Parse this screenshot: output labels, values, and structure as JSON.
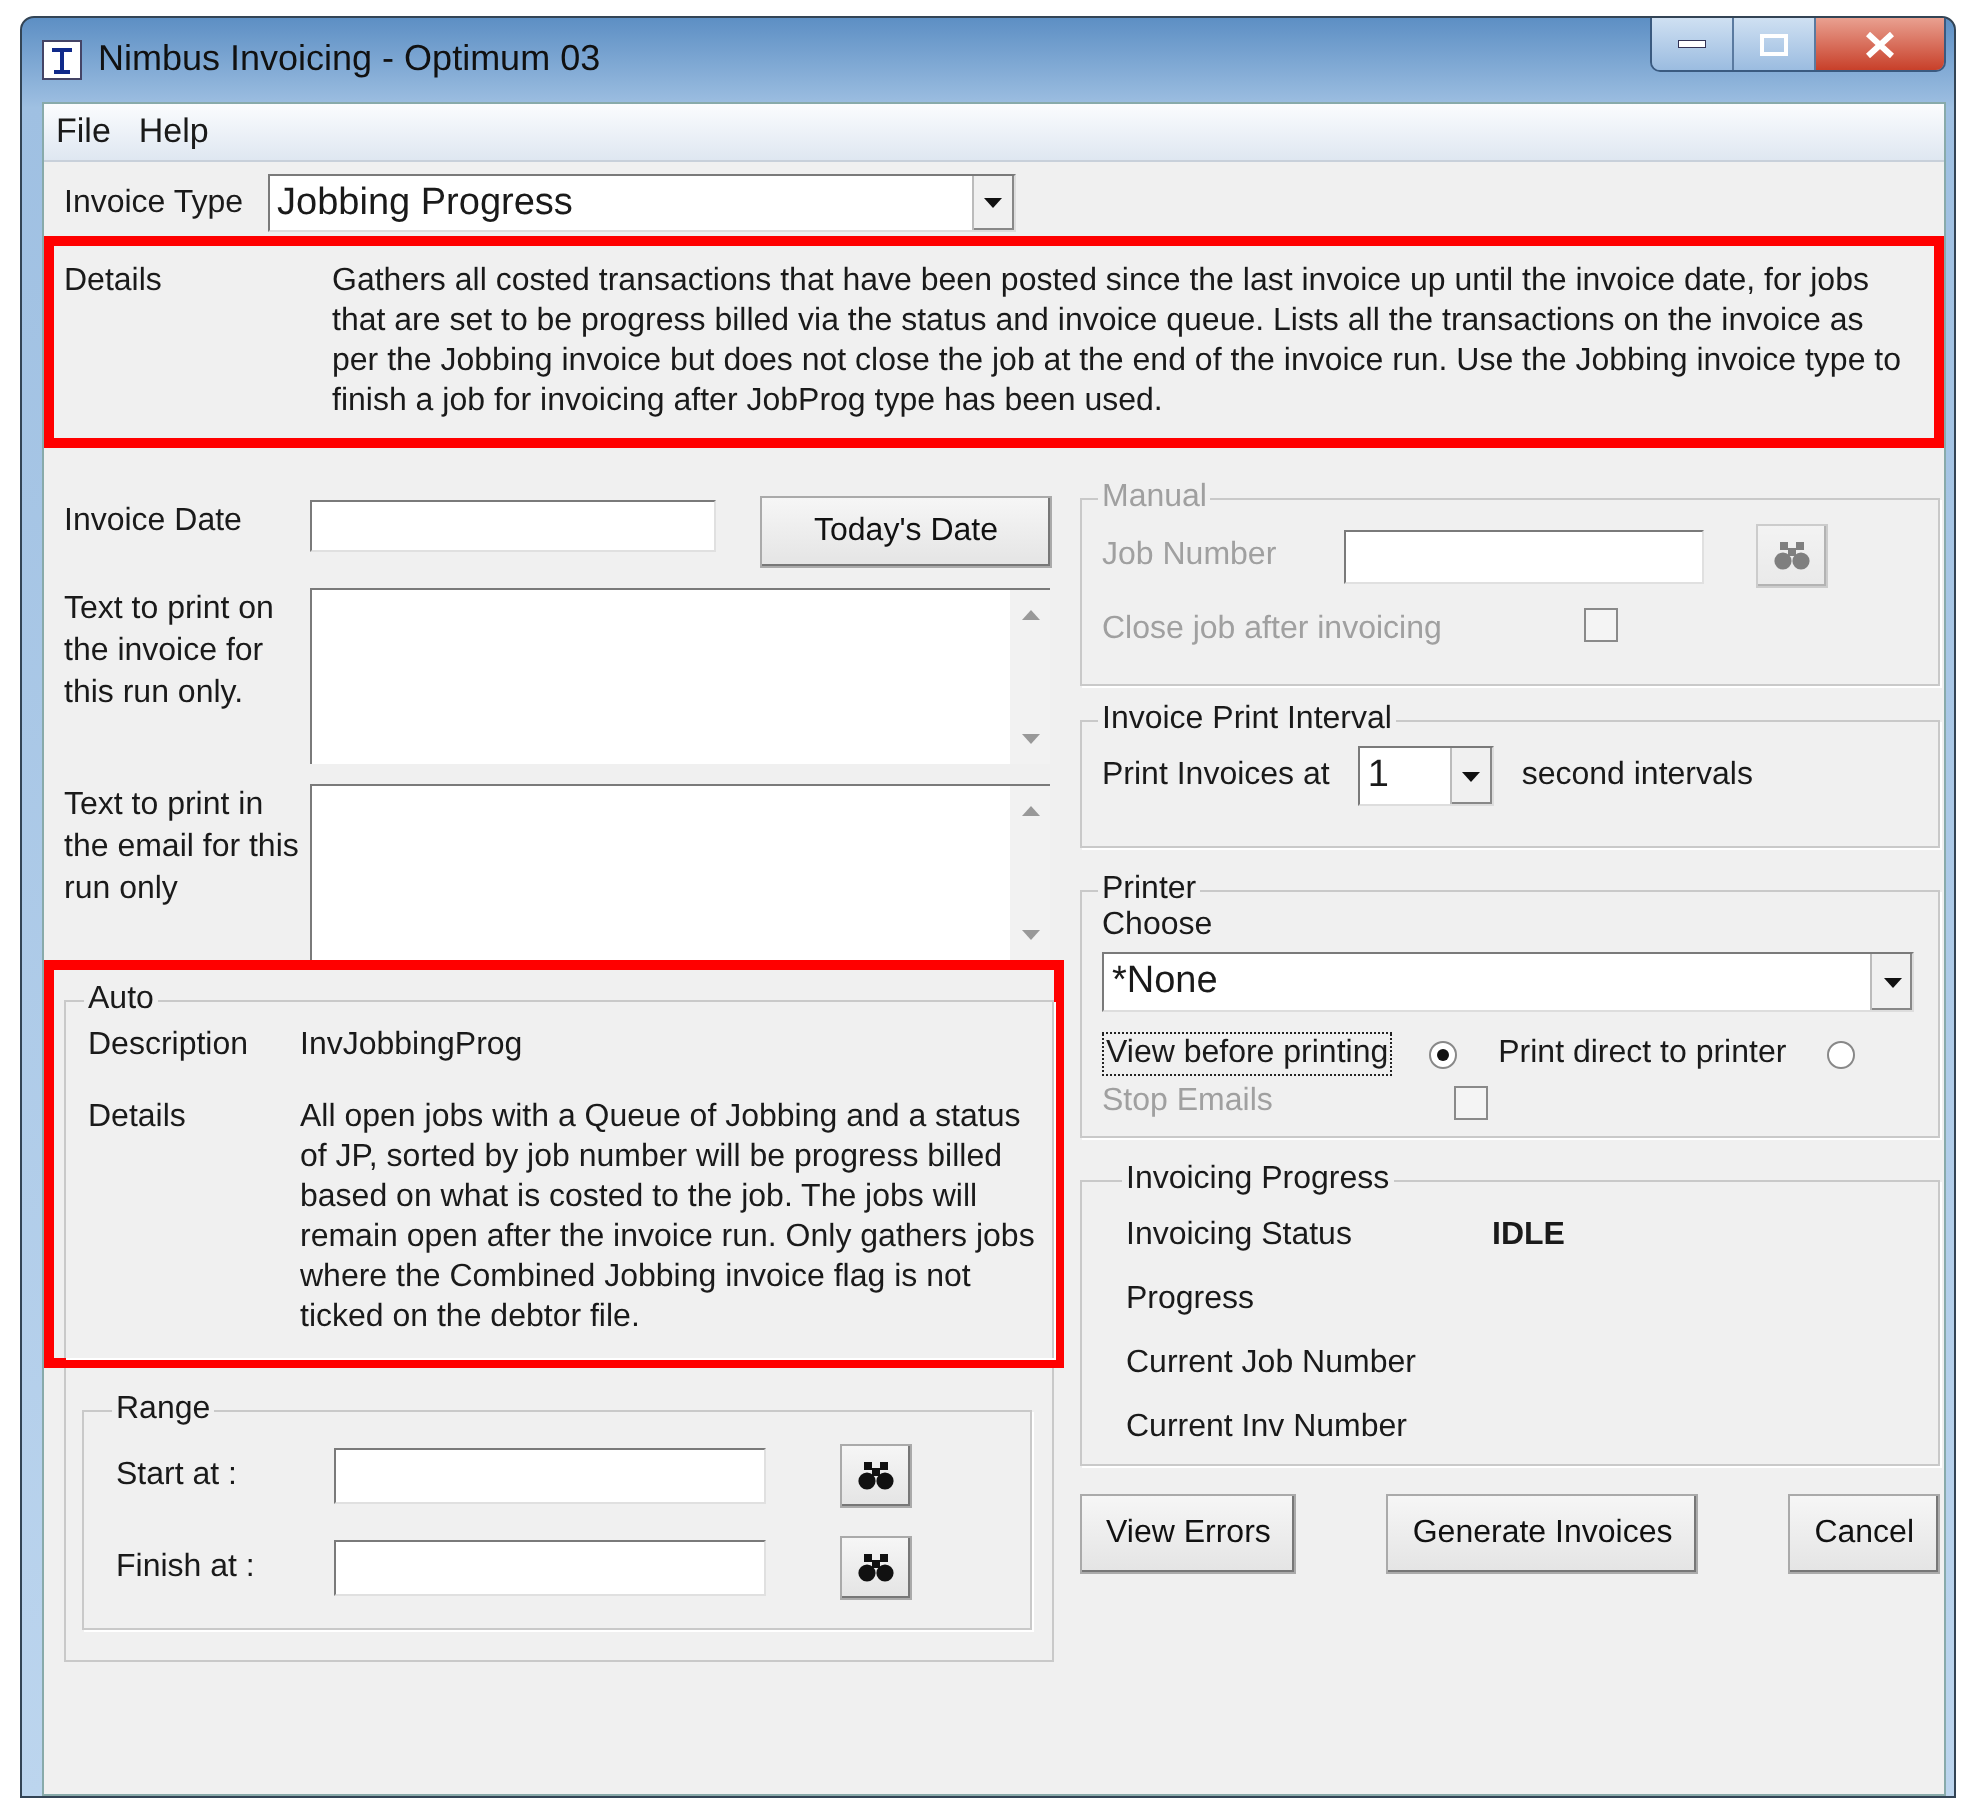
{
  "window": {
    "title": "Nimbus Invoicing - Optimum 03"
  },
  "menu": [
    "File",
    "Help"
  ],
  "invoice_type": {
    "label": "Invoice Type",
    "value": "Jobbing Progress"
  },
  "type_details": {
    "label": "Details",
    "text": "Gathers all costed transactions that have been posted since the last invoice up until the invoice date, for jobs that are set to be progress billed via the status and invoice queue.  Lists all the transactions on the invoice as per the Jobbing invoice but does not close the job at the end of the invoice run.  Use the Jobbing invoice type to finish a job for invoicing after JobProg type has been used.",
    "highlighted": true
  },
  "invoice_date": {
    "label": "Invoice Date",
    "button": "Today's Date"
  },
  "invoice_text": {
    "label": "Text to print on the invoice for this run only."
  },
  "email_text": {
    "label": "Text to print in the email for this run only"
  },
  "auto": {
    "title": "Auto",
    "highlighted": true,
    "description_label": "Description",
    "description": "InvJobbingProg",
    "details_label": "Details",
    "details": "All open jobs with a Queue of Jobbing and a status of JP, sorted by job number will be progress billed based on what is costed to the job.  The jobs will remain open after the invoice run.  Only gathers jobs where the Combined Jobbing invoice flag is not ticked on the debtor file."
  },
  "range": {
    "title": "Range",
    "start_label": "Start at :",
    "finish_label": "Finish at :"
  },
  "manual": {
    "title": "Manual",
    "disabled": true,
    "job_number_label": "Job Number",
    "close_job": {
      "label": "Close job after invoicing",
      "checked": false
    }
  },
  "print_interval": {
    "title": "Invoice Print Interval",
    "label": "Print Invoices at",
    "value": "1",
    "suffix": "second intervals"
  },
  "printer": {
    "title": "Printer",
    "choose_label": "Choose",
    "value": "*None",
    "modes": [
      {
        "label": "View before printing",
        "selected": true,
        "focused": true
      },
      {
        "label": "Print direct to printer",
        "selected": false,
        "focused": false
      }
    ],
    "stop_emails": {
      "label": "Stop Emails",
      "checked": false,
      "disabled": true
    }
  },
  "progress": {
    "title": "Invoicing Progress",
    "rows": [
      {
        "label": "Invoicing Status",
        "value": "IDLE"
      },
      {
        "label": "Progress"
      },
      {
        "label": "Current Job Number"
      },
      {
        "label": "Current Inv Number"
      }
    ]
  },
  "buttons": [
    "View Errors",
    "Generate Invoices",
    "Cancel"
  ]
}
